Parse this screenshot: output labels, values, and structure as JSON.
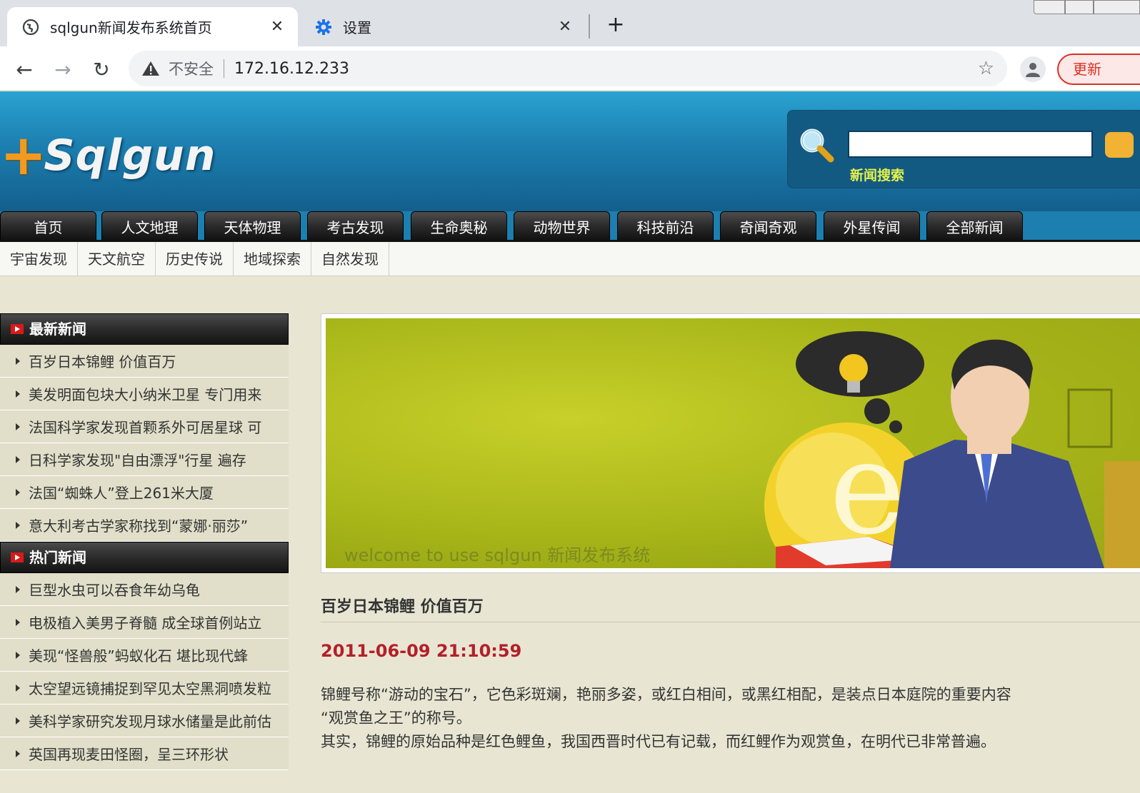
{
  "browser": {
    "tabs": [
      {
        "title": "sqlgun新闻发布系统首页",
        "active": true,
        "icon": "globe-icon"
      },
      {
        "title": "设置",
        "active": false,
        "icon": "gear-icon"
      }
    ],
    "new_tab_label": "+",
    "insecure_label": "不安全",
    "url": "172.16.12.233",
    "update_label": "更新"
  },
  "header": {
    "logo_plus": "+",
    "logo_name": "Sqlgun",
    "search_label": "新闻搜索",
    "search_value": ""
  },
  "main_nav": [
    "首页",
    "人文地理",
    "天体物理",
    "考古发现",
    "生命奥秘",
    "动物世界",
    "科技前沿",
    "奇闻奇观",
    "外星传闻",
    "全部新闻"
  ],
  "sub_nav": [
    "宇宙发现",
    "天文航空",
    "历史传说",
    "地域探索",
    "自然发现"
  ],
  "sidebar": {
    "latest_title": "最新新闻",
    "latest_items": [
      "百岁日本锦鲤 价值百万",
      "美发明面包块大小纳米卫星 专门用来",
      "法国科学家发现首颗系外可居星球 可",
      "日科学家发现\"自由漂浮\"行星 遍存",
      "法国“蜘蛛人”登上261米大厦",
      "意大利考古学家称找到“蒙娜·丽莎”"
    ],
    "hot_title": "热门新闻",
    "hot_items": [
      "巨型水虫可以吞食年幼乌龟",
      "电极植入美男子脊髓 成全球首例站立",
      "美现“怪兽般”蚂蚁化石 堪比现代蜂",
      "太空望远镜捕捉到罕见太空黑洞喷发粒",
      "美科学家研究发现月球水储量是此前估",
      "英国再现麦田怪圈，呈三环形状"
    ]
  },
  "banner": {
    "caption": "welcome to use sqlgun 新闻发布系统"
  },
  "article": {
    "title": "百岁日本锦鲤 价值百万",
    "date": "2011-06-09 21:10:59",
    "lines": [
      "锦鲤号称“游动的宝石”，它色彩斑斓，艳丽多姿，或红白相间，或黑红相配，是装点日本庭院的重要内容",
      "“观赏鱼之王”的称号。",
      "其实，锦鲤的原始品种是红色鲤鱼，我国西晋时代已有记载，而红鲤作为观赏鱼，在明代已非常普遍。"
    ]
  },
  "colors": {
    "header_blue": "#1c7fb0",
    "logo_orange": "#f39a1e",
    "search_label_yellow": "#e6f24a",
    "date_red": "#b3202a",
    "sidebar_bg": "#e1dfc9",
    "page_bg": "#e8e6d3"
  }
}
